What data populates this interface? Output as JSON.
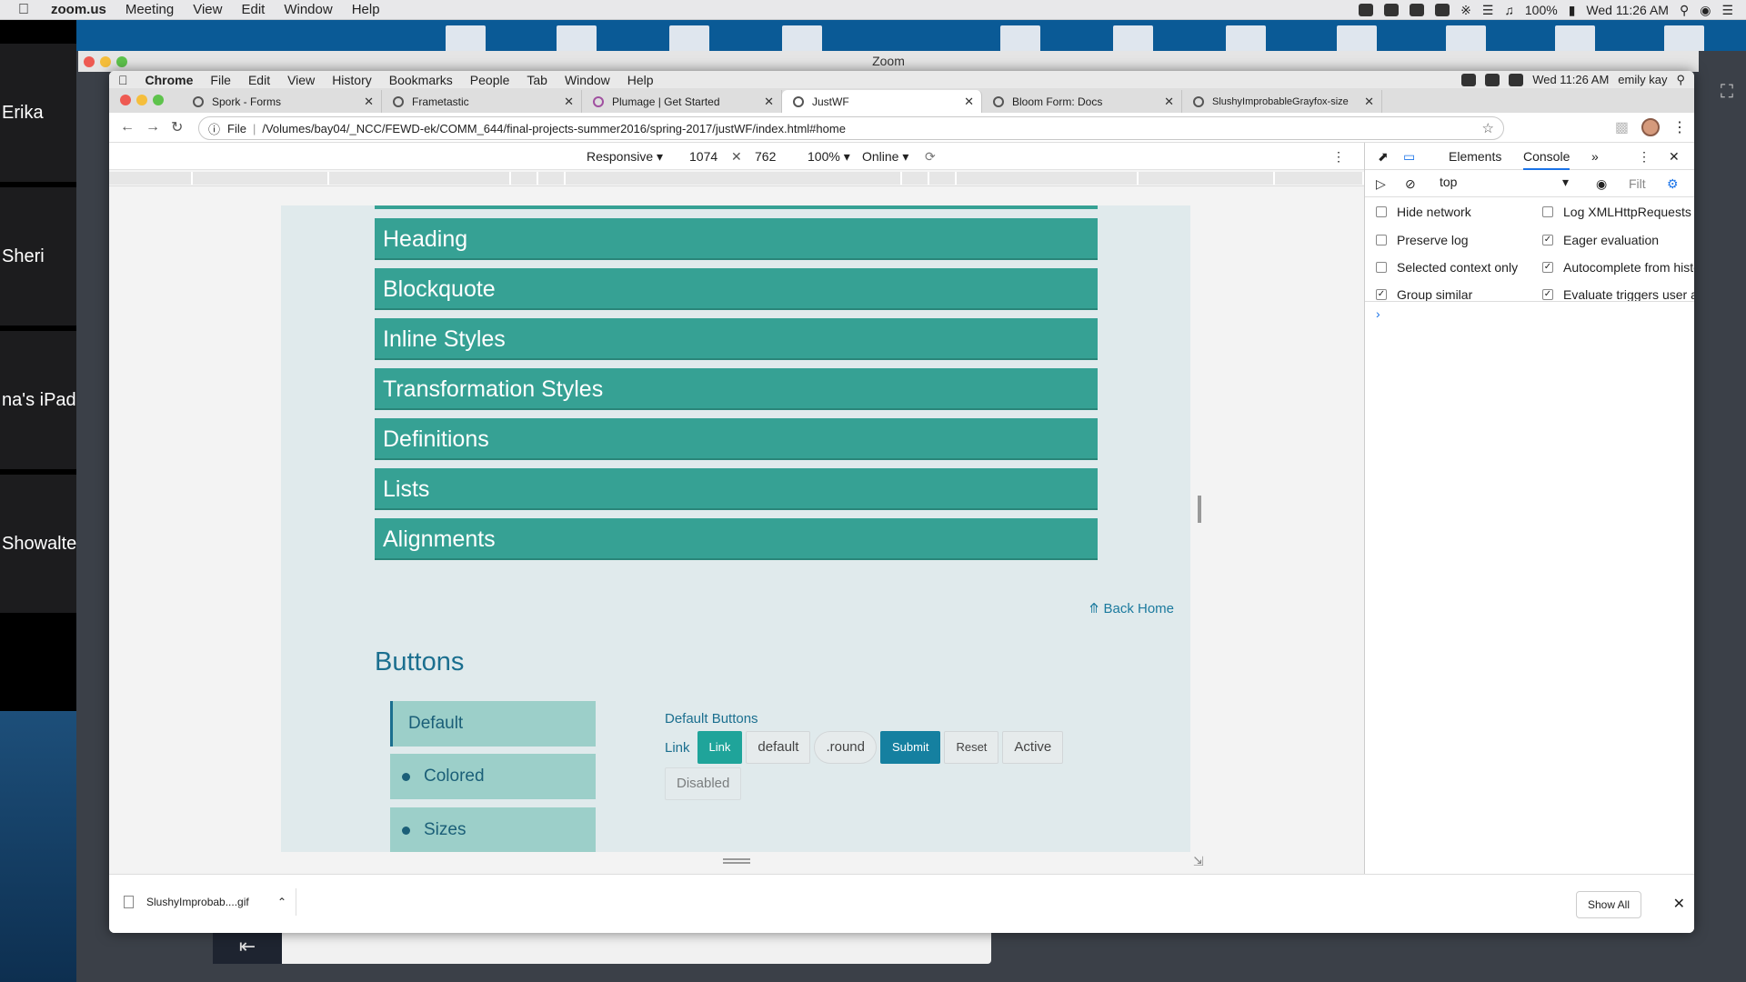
{
  "mac_menubar": {
    "app": "zoom.us",
    "items": [
      "Meeting",
      "View",
      "Edit",
      "Window",
      "Help"
    ],
    "battery": "100%",
    "clock": "Wed 11:26 AM"
  },
  "zoom": {
    "window_title": "Zoom",
    "participants": [
      "Erika",
      "Sheri",
      "na's iPad",
      "Showalte"
    ]
  },
  "chrome_menu": {
    "app": "Chrome",
    "items": [
      "File",
      "Edit",
      "View",
      "History",
      "Bookmarks",
      "People",
      "Tab",
      "Window",
      "Help"
    ],
    "clock": "Wed 11:26 AM",
    "user": "emily kay"
  },
  "tabs": [
    {
      "label": "Spork - Forms",
      "active": false
    },
    {
      "label": "Frametastic",
      "active": false
    },
    {
      "label": "Plumage | Get Started",
      "active": false
    },
    {
      "label": "JustWF",
      "active": true
    },
    {
      "label": "Bloom Form: Docs",
      "active": false
    },
    {
      "label": "SlushyImprobableGrayfox-size",
      "active": false
    }
  ],
  "address_bar": {
    "scheme": "File",
    "url": "/Volumes/bay04/_NCC/FEWD-ek/COMM_644/final-projects-summer2016/spring-2017/justWF/index.html#home"
  },
  "device_toolbar": {
    "mode": "Responsive",
    "width": "1074",
    "height": "762",
    "zoom": "100%",
    "network": "Online"
  },
  "page": {
    "section_bars": [
      "Heading",
      "Blockquote",
      "Inline Styles",
      "Transformation Styles",
      "Definitions",
      "Lists",
      "Alignments"
    ],
    "back_home": "Back Home",
    "buttons_heading": "Buttons",
    "side_menu": [
      "Default",
      "Colored",
      "Sizes"
    ],
    "default_buttons_label": "Default Buttons",
    "link_text": "Link",
    "buttons": [
      "Link",
      "default",
      ".round",
      "Submit",
      "Reset",
      "Active"
    ],
    "disabled_button": "Disabled"
  },
  "devtools": {
    "tabs": [
      "Elements",
      "Console"
    ],
    "active_tab": "Console",
    "context": "top",
    "filter": "Filt",
    "options_left": [
      {
        "label": "Hide network",
        "checked": false
      },
      {
        "label": "Preserve log",
        "checked": false
      },
      {
        "label": "Selected context only",
        "checked": false
      },
      {
        "label": "Group similar",
        "checked": true
      }
    ],
    "options_right": [
      {
        "label": "Log XMLHttpRequests",
        "checked": false
      },
      {
        "label": "Eager evaluation",
        "checked": true
      },
      {
        "label": "Autocomplete from histo",
        "checked": true
      },
      {
        "label": "Evaluate triggers user ac",
        "checked": true
      }
    ]
  },
  "download_bar": {
    "file": "SlushyImprobab....gif",
    "show_all": "Show All"
  },
  "colors": {
    "teal_bar": "#36a194",
    "page_bg": "#e0eaec",
    "accent_blue": "#1b6f8f"
  }
}
